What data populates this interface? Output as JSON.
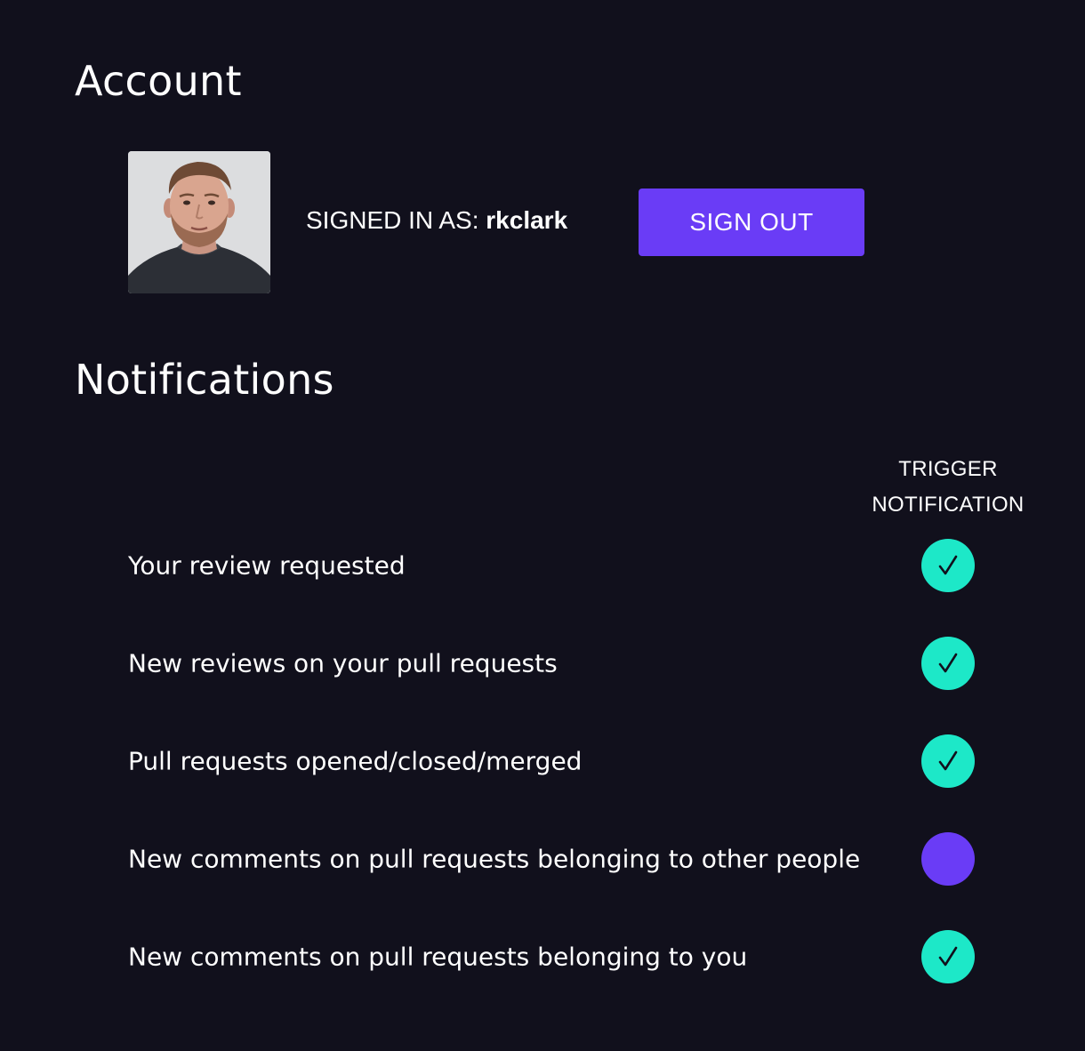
{
  "account": {
    "title": "Account",
    "signed_in_prefix": "SIGNED IN AS:",
    "username": "rkclark",
    "sign_out_label": "SIGN OUT"
  },
  "notifications": {
    "title": "Notifications",
    "column_header_line1": "TRIGGER",
    "column_header_line2": "NOTIFICATION",
    "items": [
      {
        "label": "Your review requested",
        "enabled": true
      },
      {
        "label": "New reviews on your pull requests",
        "enabled": true
      },
      {
        "label": "Pull requests opened/closed/merged",
        "enabled": true
      },
      {
        "label": "New comments on pull requests belonging to other people",
        "enabled": false
      },
      {
        "label": "New comments on pull requests belonging to you",
        "enabled": true
      }
    ]
  },
  "colors": {
    "background": "#11101c",
    "accent": "#6a3cf6",
    "toggle_on": "#1de8c8"
  },
  "icons": {
    "toggle_on": "check-icon"
  }
}
